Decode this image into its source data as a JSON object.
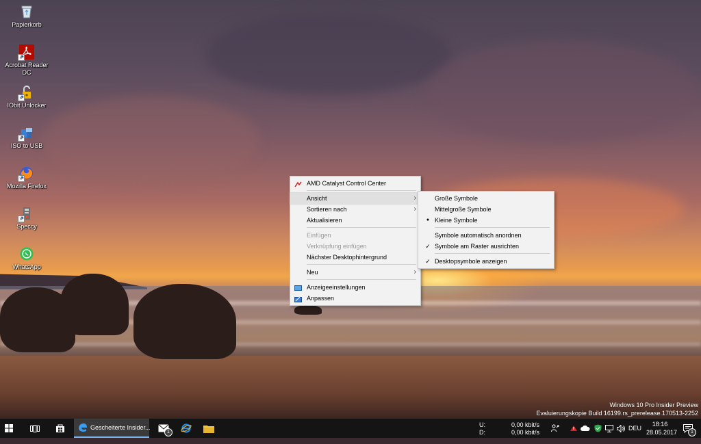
{
  "desktop": {
    "icons": [
      {
        "label": "Papierkorb",
        "icon": "recycle-bin-icon"
      },
      {
        "label": "Acrobat Reader DC",
        "icon": "acrobat-reader-icon"
      },
      {
        "label": "IObit Unlocker",
        "icon": "iobit-unlocker-icon"
      },
      {
        "label": "ISO to USB",
        "icon": "iso-to-usb-icon"
      },
      {
        "label": "Mozilla Firefox",
        "icon": "firefox-icon"
      },
      {
        "label": "Speccy",
        "icon": "speccy-icon"
      },
      {
        "label": "WhatsApp",
        "icon": "whatsapp-icon"
      }
    ]
  },
  "context_menu": {
    "items": [
      {
        "label": "AMD Catalyst Control Center"
      },
      {
        "label": "Ansicht"
      },
      {
        "label": "Sortieren nach"
      },
      {
        "label": "Aktualisieren"
      },
      {
        "label": "Einfügen"
      },
      {
        "label": "Verknüpfung einfügen"
      },
      {
        "label": "Nächster Desktophintergrund"
      },
      {
        "label": "Neu"
      },
      {
        "label": "Anzeigeeinstellungen"
      },
      {
        "label": "Anpassen"
      }
    ]
  },
  "submenu": {
    "items": [
      {
        "label": "Große Symbole",
        "mark": ""
      },
      {
        "label": "Mittelgroße Symbole",
        "mark": ""
      },
      {
        "label": "Kleine Symbole",
        "mark": "●"
      },
      {
        "label": "Symbole automatisch anordnen",
        "mark": ""
      },
      {
        "label": "Symbole am Raster ausrichten",
        "mark": "✓"
      },
      {
        "label": "Desktopsymbole anzeigen",
        "mark": "✓"
      }
    ]
  },
  "watermark": {
    "line1": "Windows 10 Pro Insider Preview",
    "line2": "Evaluierungskopie Build 16199.rs_prerelease.170513-2252"
  },
  "taskbar": {
    "active_window_title": "Gescheiterte Insider...",
    "mail_badge": "1",
    "network": {
      "up_label": "U:",
      "down_label": "D:",
      "up_value": "0,00 kbit/s",
      "down_value": "0,00 kbit/s"
    },
    "language": "DEU",
    "time": "18:16",
    "date": "28.05.2017",
    "notification_count": "1"
  },
  "colors": {
    "accent": "#0078d7",
    "taskbar": "#141414",
    "menu_bg": "#f2f2f2"
  }
}
